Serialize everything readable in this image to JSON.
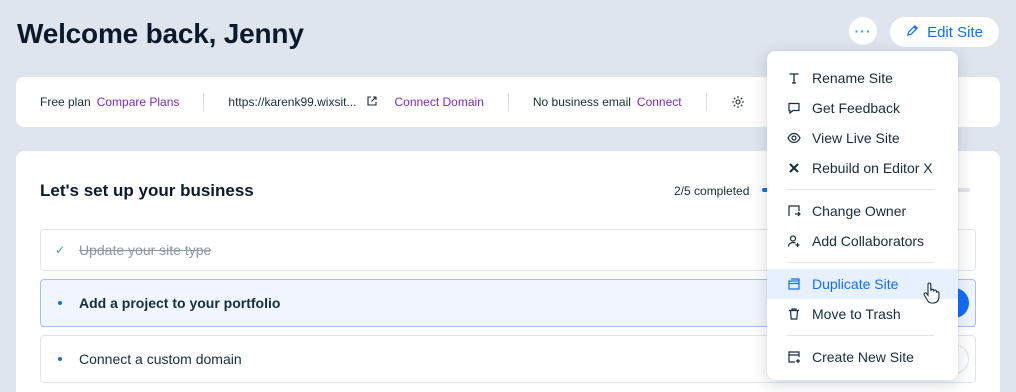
{
  "header": {
    "title": "Welcome back, Jenny",
    "more_label": "···",
    "edit_label": "Edit Site"
  },
  "infobar": {
    "plan_text": "Free plan",
    "compare_link": "Compare Plans",
    "site_url": "https://karenk99.wixsit...",
    "connect_domain_link": "Connect Domain",
    "email_text": "No business email",
    "email_connect_link": "Connect"
  },
  "setup": {
    "title": "Let's set up your business",
    "progress_text": "2/5 completed",
    "progress_value": 0.4,
    "tasks": [
      {
        "label": "Update your site type",
        "status": "done"
      },
      {
        "label": "Add a project to your portfolio",
        "status": "active"
      },
      {
        "label": "Connect a custom domain",
        "status": "pending"
      }
    ]
  },
  "menu": {
    "items": [
      {
        "label": "Rename Site",
        "icon": "text-icon"
      },
      {
        "label": "Get Feedback",
        "icon": "chat-icon"
      },
      {
        "label": "View Live Site",
        "icon": "eye-icon"
      },
      {
        "label": "Rebuild on Editor X",
        "icon": "editor-x-icon"
      },
      {
        "label": "Change Owner",
        "icon": "transfer-icon"
      },
      {
        "label": "Add Collaborators",
        "icon": "add-user-icon"
      },
      {
        "label": "Duplicate Site",
        "icon": "duplicate-icon",
        "highlighted": true
      },
      {
        "label": "Move to Trash",
        "icon": "trash-icon"
      },
      {
        "label": "Create New Site",
        "icon": "new-site-icon"
      }
    ]
  },
  "colors": {
    "accent": "#116dff",
    "link_purple": "#7a2bb5",
    "background": "#dfe5ee",
    "highlight": "#e7f0ff",
    "check_green": "#3fa86b"
  }
}
